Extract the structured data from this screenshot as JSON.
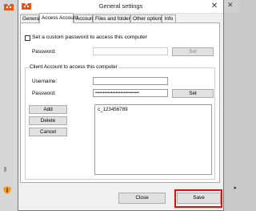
{
  "window": {
    "title": "General settings",
    "close_glyph": "✕"
  },
  "tabs": [
    {
      "label": "General",
      "active": false
    },
    {
      "label": "Access Account",
      "active": true
    },
    {
      "label": "Account",
      "active": false
    },
    {
      "label": "Files and folders",
      "active": false
    },
    {
      "label": "Other options",
      "active": false
    },
    {
      "label": "Info",
      "active": false
    }
  ],
  "custom_password": {
    "checkbox_label": "Set a custom password to access this computer",
    "checked": false,
    "password_label": "Password:",
    "password_value": "",
    "set_label": "Set"
  },
  "client_account": {
    "group_title": "Client Account to access this computer",
    "username_label": "Username:",
    "username_value": "",
    "password_label": "Password:",
    "password_value": "••••••••••••••••••••••••••••",
    "set_label": "Set",
    "add_label": "Add",
    "delete_label": "Delete",
    "cancel_label": "Cancel",
    "accounts": [
      "c_123456789"
    ]
  },
  "footer": {
    "close_label": "Close",
    "save_label": "Save"
  },
  "icons": {
    "app_icon": "app-logo-icon",
    "close": "close-icon"
  },
  "colors": {
    "highlight": "#e01010",
    "app_icon": "#e8541c"
  }
}
